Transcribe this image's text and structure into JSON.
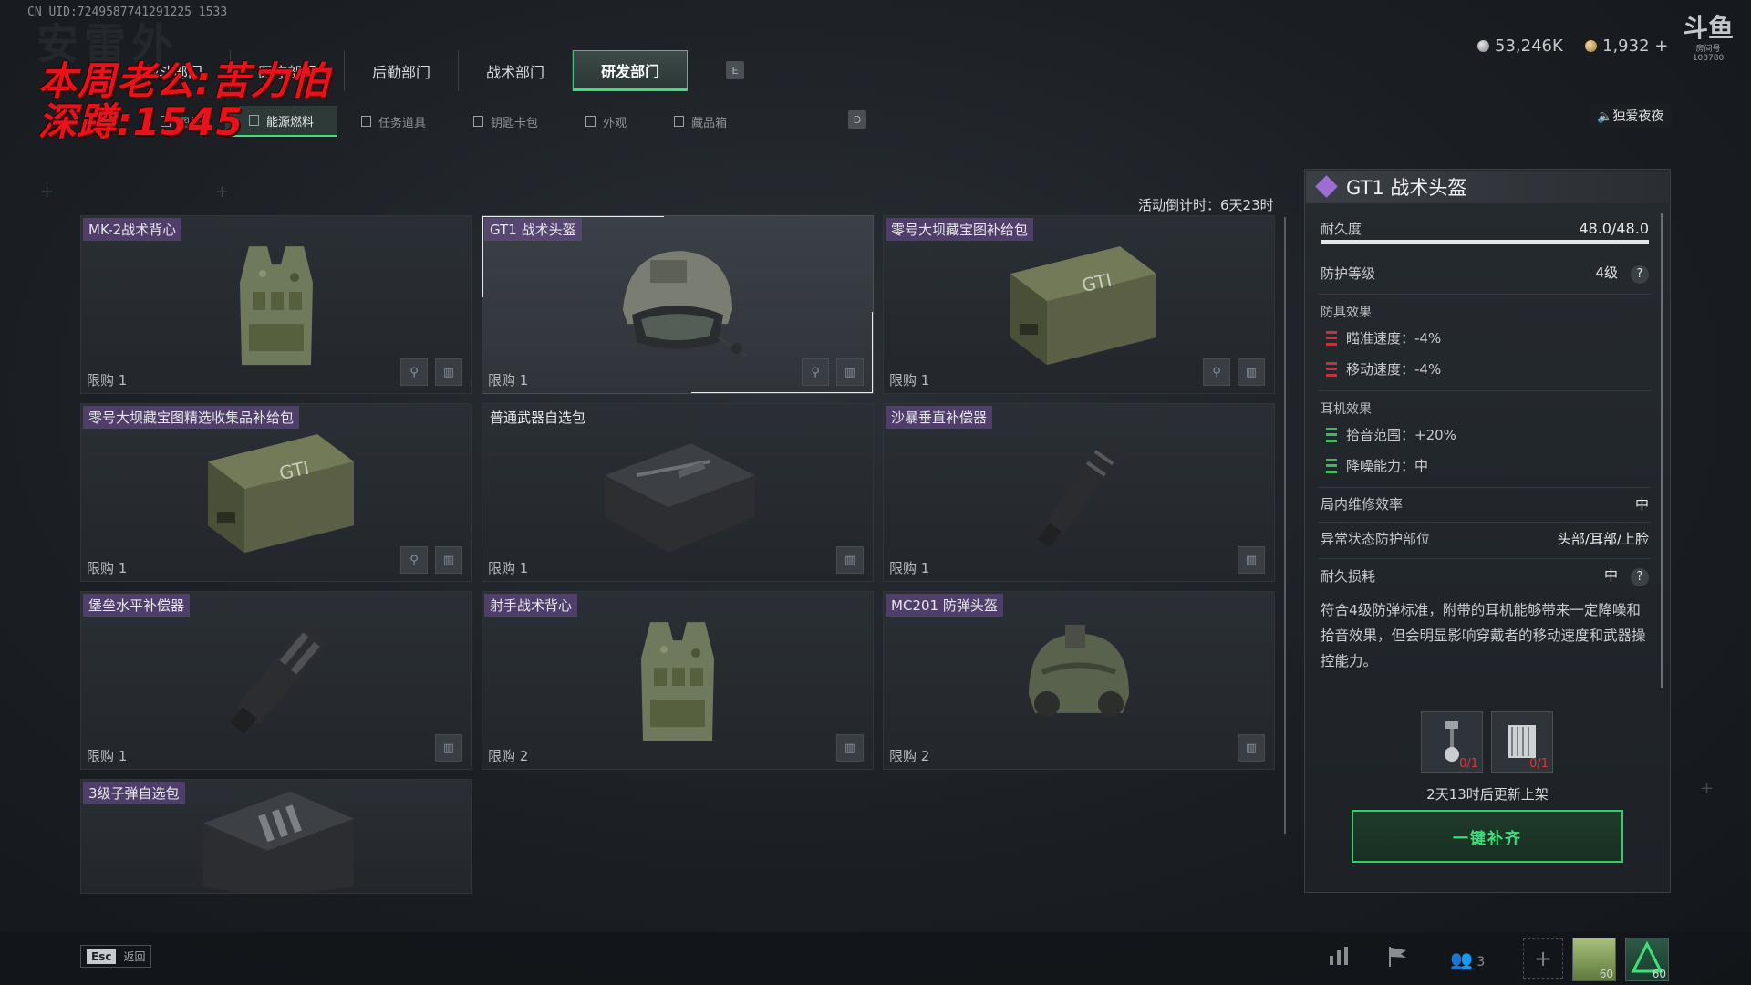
{
  "header": {
    "uid": "CN UID:7249587741291225 1533",
    "bg_title": "安雷外"
  },
  "overlay": {
    "line1": "本周老公:苦力怕",
    "line2": "深蹲:1545"
  },
  "tabs": [
    {
      "label": "战斗部门",
      "active": false
    },
    {
      "label": "医疗部门",
      "active": false
    },
    {
      "label": "后勤部门",
      "active": false
    },
    {
      "label": "战术部门",
      "active": false
    },
    {
      "label": "研发部门",
      "active": true
    }
  ],
  "tab_key": "E",
  "subtabs": [
    {
      "label": "图纸",
      "active": false
    },
    {
      "label": "能源燃料",
      "active": true
    },
    {
      "label": "任务道具",
      "active": false
    },
    {
      "label": "钥匙卡包",
      "active": false
    },
    {
      "label": "外观",
      "active": false
    },
    {
      "label": "藏品箱",
      "active": false
    }
  ],
  "subtab_key": "D",
  "currency": {
    "silver": "53,246K",
    "gold": "1,932 +"
  },
  "logo": {
    "text": "斗鱼",
    "sub": "房间号",
    "room": "108780"
  },
  "music": "独爱夜夜",
  "countdown": "活动倒计时：6天23时",
  "items": [
    {
      "name": "MK-2战术背心",
      "limit": "限购 1",
      "icons": 2,
      "art": "vest",
      "plain": false
    },
    {
      "name": "GT1 战术头盔",
      "limit": "限购 1",
      "icons": 2,
      "art": "helmet",
      "plain": false,
      "selected": true
    },
    {
      "name": "零号大坝藏宝图补给包",
      "limit": "限购 1",
      "icons": 2,
      "art": "case",
      "plain": false
    },
    {
      "name": "零号大坝藏宝图精选收集品补给包",
      "limit": "限购 1",
      "icons": 2,
      "art": "case",
      "plain": false
    },
    {
      "name": "普通武器自选包",
      "limit": "限购 1",
      "icons": 1,
      "art": "blackcase",
      "plain": true
    },
    {
      "name": "沙暴垂直补偿器",
      "limit": "限购 1",
      "icons": 1,
      "art": "comp",
      "plain": false
    },
    {
      "name": "堡垒水平补偿器",
      "limit": "限购 1",
      "icons": 1,
      "art": "comp2",
      "plain": false
    },
    {
      "name": "射手战术背心",
      "limit": "限购 2",
      "icons": 1,
      "art": "vest",
      "plain": false
    },
    {
      "name": "MC201 防弹头盔",
      "limit": "限购 2",
      "icons": 1,
      "art": "helmet2",
      "plain": false
    },
    {
      "name": "3级子弹自选包",
      "limit": "",
      "icons": 0,
      "art": "ammo",
      "plain": false
    }
  ],
  "detail": {
    "title": "GT1 战术头盔",
    "durability_label": "耐久度",
    "durability_value": "48.0/48.0",
    "durability_ratio": 1.0,
    "protection_label": "防护等级",
    "protection_value": "4级",
    "armor_section": "防具效果",
    "armor_effects": [
      {
        "label": "瞄准速度：-4%"
      },
      {
        "label": "移动速度：-4%"
      }
    ],
    "ear_section": "耳机效果",
    "ear_effects": [
      {
        "label": "拾音范围：+20%"
      },
      {
        "label": "降噪能力：中"
      }
    ],
    "repair_label": "局内维修效率",
    "repair_value": "中",
    "abnormal_label": "异常状态防护部位",
    "abnormal_value": "头部/耳部/上脸",
    "loss_label": "耐久损耗",
    "loss_value": "中",
    "qmark": "?",
    "description": "符合4级防弹标准，附带的耳机能够带来一定降噪和拾音效果，但会明显影响穿戴者的移动速度和武器操控能力。",
    "slots": [
      {
        "count": "0/1"
      },
      {
        "count": "0/1"
      }
    ],
    "restock": "2天13时后更新上架",
    "fill_button": "一键补齐"
  },
  "bottom": {
    "esc_key": "Esc",
    "esc_label": "返回",
    "friends_count": "3",
    "avatar1_level": "60",
    "avatar2_level": "60"
  }
}
